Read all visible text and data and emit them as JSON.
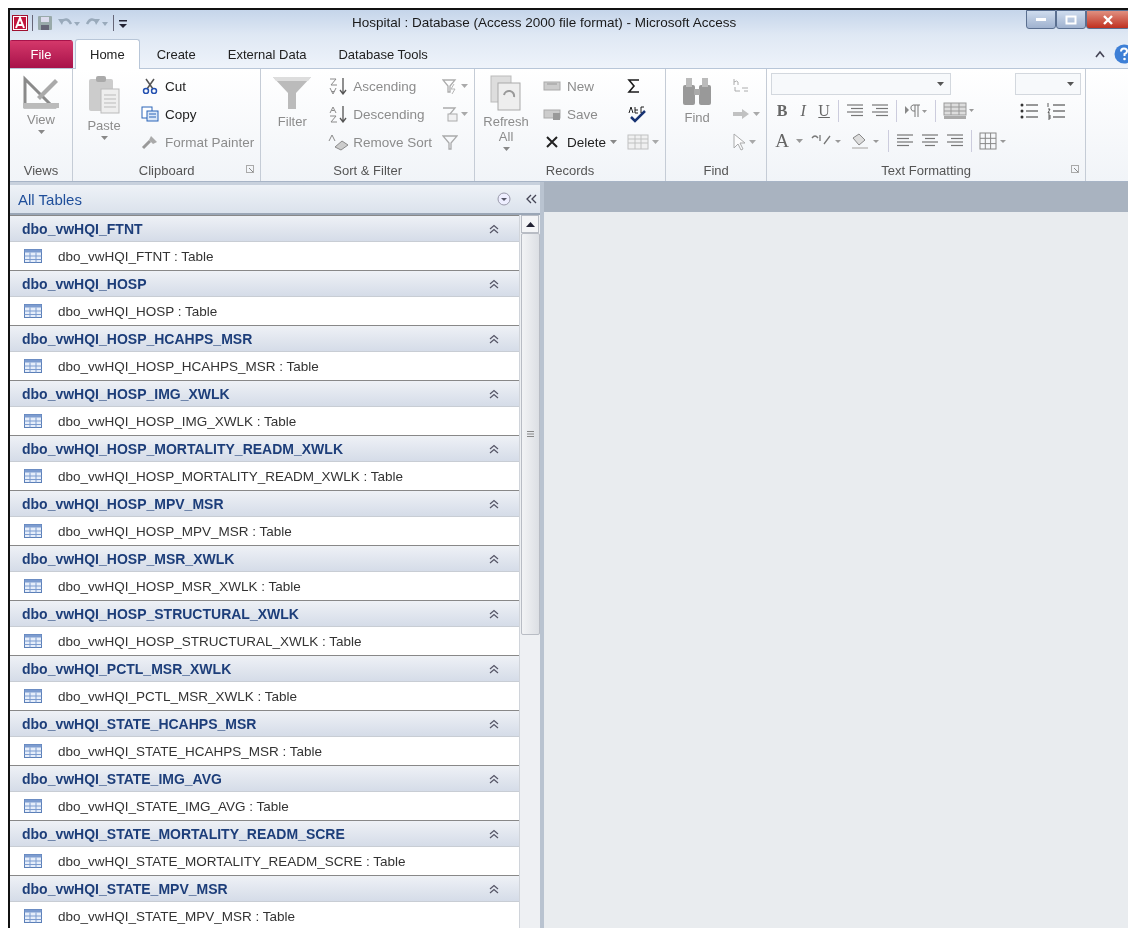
{
  "window": {
    "title": "Hospital : Database (Access 2000 file format)  -  Microsoft Access"
  },
  "ribbon_tabs": [
    {
      "label": "File",
      "kind": "file",
      "selected": false
    },
    {
      "label": "Home",
      "kind": "tab",
      "selected": true
    },
    {
      "label": "Create",
      "kind": "tab",
      "selected": false
    },
    {
      "label": "External Data",
      "kind": "tab",
      "selected": false
    },
    {
      "label": "Database Tools",
      "kind": "tab",
      "selected": false
    }
  ],
  "ribbon_groups": [
    {
      "label": "Views",
      "launcher": false,
      "columns": [
        [
          {
            "kind": "large",
            "label": "View",
            "dropdown": true,
            "disabled": true
          }
        ]
      ]
    },
    {
      "label": "Clipboard",
      "launcher": true,
      "columns": [
        [
          {
            "kind": "large",
            "label": "Paste",
            "dropdown": true,
            "disabled": true
          }
        ],
        [
          {
            "kind": "small",
            "label": "Cut",
            "disabled": false
          },
          {
            "kind": "small",
            "label": "Copy",
            "disabled": false
          },
          {
            "kind": "small",
            "label": "Format Painter",
            "disabled": true
          }
        ]
      ]
    },
    {
      "label": "Sort & Filter",
      "launcher": false,
      "columns": [
        [
          {
            "kind": "large",
            "label": "Filter",
            "dropdown": false,
            "disabled": true
          }
        ],
        [
          {
            "kind": "small",
            "label": "Ascending",
            "disabled": true
          },
          {
            "kind": "small",
            "label": "Descending",
            "disabled": true
          },
          {
            "kind": "small",
            "label": "Remove Sort",
            "disabled": true
          }
        ],
        [
          {
            "kind": "icon",
            "dropdown": true,
            "disabled": true
          },
          {
            "kind": "icon",
            "dropdown": true,
            "disabled": true
          },
          {
            "kind": "icon",
            "dropdown": false,
            "disabled": true
          }
        ]
      ]
    },
    {
      "label": "Records",
      "launcher": false,
      "columns": [
        [
          {
            "kind": "large",
            "label": "Refresh All",
            "dropdown": true,
            "disabled": true
          }
        ],
        [
          {
            "kind": "small",
            "label": "New",
            "disabled": true
          },
          {
            "kind": "small",
            "label": "Save",
            "disabled": true
          },
          {
            "kind": "small",
            "label": "Delete",
            "dropdown": true,
            "disabled": false
          }
        ],
        [
          {
            "kind": "icon",
            "dropdown": false,
            "disabled": false
          },
          {
            "kind": "icon",
            "dropdown": false,
            "disabled": false
          },
          {
            "kind": "icon",
            "dropdown": true,
            "disabled": true
          }
        ]
      ]
    },
    {
      "label": "Find",
      "launcher": false,
      "columns": [
        [
          {
            "kind": "large",
            "label": "Find",
            "dropdown": false,
            "disabled": true
          }
        ],
        [
          {
            "kind": "icon",
            "dropdown": false,
            "disabled": true
          },
          {
            "kind": "icon",
            "dropdown": true,
            "disabled": true
          },
          {
            "kind": "icon",
            "dropdown": true,
            "disabled": true
          }
        ]
      ]
    },
    {
      "label": "Text Formatting",
      "launcher": true,
      "columns": [
        [
          {
            "kind": "combo",
            "disabled": true
          },
          {
            "kind": "icon-row",
            "letters": [
              "B",
              "I",
              "U"
            ],
            "disabled": true
          },
          {
            "kind": "icon-row",
            "letters": [
              "A"
            ],
            "disabled": true
          }
        ],
        [
          {
            "kind": "combo",
            "disabled": true
          }
        ]
      ]
    }
  ],
  "navigation_pane": {
    "title": "All Tables",
    "groups": [
      {
        "name": "dbo_vwHQI_FTNT",
        "expanded": true,
        "items": [
          "dbo_vwHQI_FTNT : Table"
        ]
      },
      {
        "name": "dbo_vwHQI_HOSP",
        "expanded": true,
        "items": [
          "dbo_vwHQI_HOSP : Table"
        ]
      },
      {
        "name": "dbo_vwHQI_HOSP_HCAHPS_MSR",
        "expanded": true,
        "items": [
          "dbo_vwHQI_HOSP_HCAHPS_MSR : Table"
        ]
      },
      {
        "name": "dbo_vwHQI_HOSP_IMG_XWLK",
        "expanded": true,
        "items": [
          "dbo_vwHQI_HOSP_IMG_XWLK : Table"
        ]
      },
      {
        "name": "dbo_vwHQI_HOSP_MORTALITY_READM_XWLK",
        "expanded": true,
        "items": [
          "dbo_vwHQI_HOSP_MORTALITY_READM_XWLK : Table"
        ]
      },
      {
        "name": "dbo_vwHQI_HOSP_MPV_MSR",
        "expanded": true,
        "items": [
          "dbo_vwHQI_HOSP_MPV_MSR : Table"
        ]
      },
      {
        "name": "dbo_vwHQI_HOSP_MSR_XWLK",
        "expanded": true,
        "items": [
          "dbo_vwHQI_HOSP_MSR_XWLK : Table"
        ]
      },
      {
        "name": "dbo_vwHQI_HOSP_STRUCTURAL_XWLK",
        "expanded": true,
        "items": [
          "dbo_vwHQI_HOSP_STRUCTURAL_XWLK : Table"
        ]
      },
      {
        "name": "dbo_vwHQI_PCTL_MSR_XWLK",
        "expanded": true,
        "items": [
          "dbo_vwHQI_PCTL_MSR_XWLK : Table"
        ]
      },
      {
        "name": "dbo_vwHQI_STATE_HCAHPS_MSR",
        "expanded": true,
        "items": [
          "dbo_vwHQI_STATE_HCAHPS_MSR : Table"
        ]
      },
      {
        "name": "dbo_vwHQI_STATE_IMG_AVG",
        "expanded": true,
        "items": [
          "dbo_vwHQI_STATE_IMG_AVG : Table"
        ]
      },
      {
        "name": "dbo_vwHQI_STATE_MORTALITY_READM_SCRE",
        "expanded": true,
        "items": [
          "dbo_vwHQI_STATE_MORTALITY_READM_SCRE : Table"
        ]
      },
      {
        "name": "dbo_vwHQI_STATE_MPV_MSR",
        "expanded": true,
        "items": [
          "dbo_vwHQI_STATE_MPV_MSR : Table"
        ]
      }
    ]
  }
}
